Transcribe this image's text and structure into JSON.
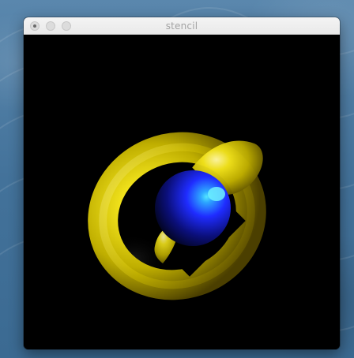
{
  "window": {
    "title": "stencil"
  },
  "scene": {
    "background": "#000000",
    "torus_color": "#e3d400",
    "sphere_color": "#1f2cff",
    "sphere_highlight": "#42d6ff",
    "diamond_color": "#000000"
  }
}
